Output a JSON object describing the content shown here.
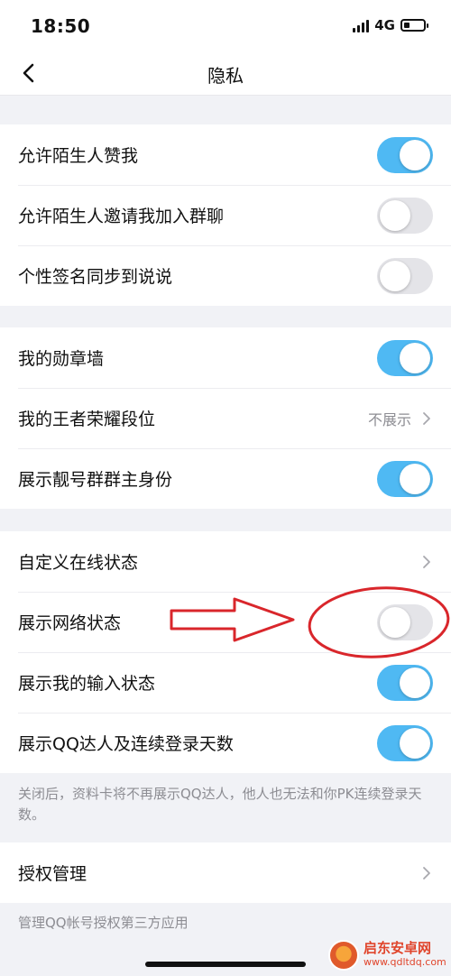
{
  "status_bar": {
    "time": "18:50",
    "network": "4G"
  },
  "nav": {
    "title": "隐私"
  },
  "groups": [
    {
      "rows": [
        {
          "label": "允许陌生人赞我",
          "toggle": "on"
        },
        {
          "label": "允许陌生人邀请我加入群聊",
          "toggle": "off"
        },
        {
          "label": "个性签名同步到说说",
          "toggle": "off"
        }
      ]
    },
    {
      "rows": [
        {
          "label": "我的勋章墙",
          "toggle": "on"
        },
        {
          "label": "我的王者荣耀段位",
          "value": "不展示"
        },
        {
          "label": "展示靓号群群主身份",
          "toggle": "on"
        }
      ]
    },
    {
      "rows": [
        {
          "label": "自定义在线状态"
        },
        {
          "label": "展示网络状态",
          "toggle": "off"
        },
        {
          "label": "展示我的输入状态",
          "toggle": "on"
        },
        {
          "label": "展示QQ达人及连续登录天数",
          "toggle": "on"
        }
      ],
      "footnote": "关闭后，资料卡将不再展示QQ达人，他人也无法和你PK连续登录天数。"
    },
    {
      "rows": [
        {
          "label": "授权管理"
        }
      ],
      "footnote": "管理QQ帐号授权第三方应用"
    }
  ],
  "watermark": {
    "title": "启东安卓网",
    "url": "www.qdltdq.com"
  },
  "colors": {
    "toggle_on": "#4fb9f3",
    "toggle_off": "#e4e4e8",
    "annotation": "#d9262b"
  }
}
